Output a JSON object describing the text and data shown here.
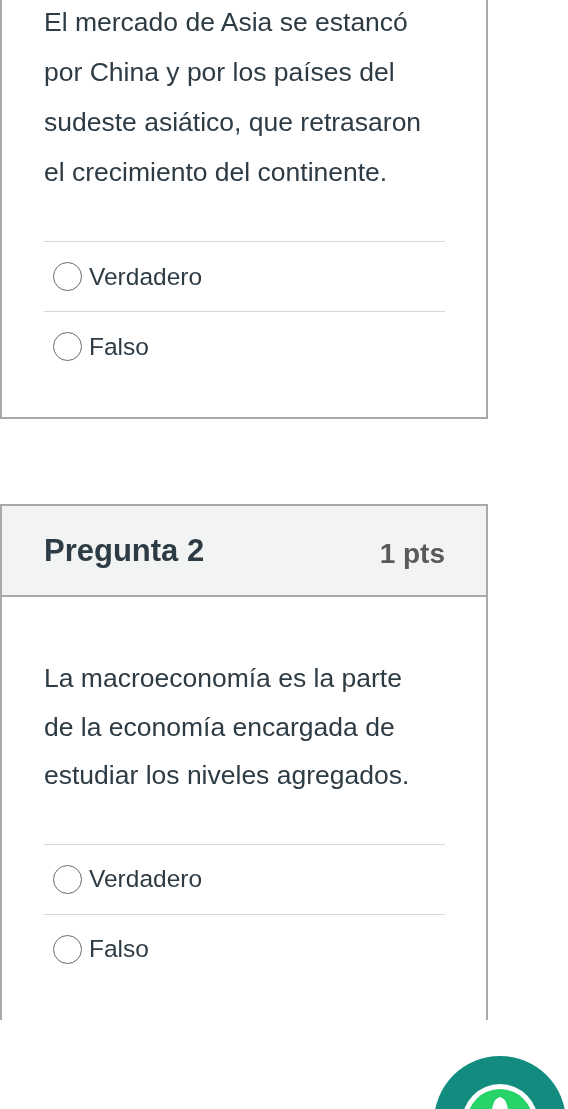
{
  "questions": [
    {
      "text": "El mercado de Asia se estancó por China y por los países del sudeste asiático, que retrasaron el crecimiento del continente.",
      "options": [
        {
          "label": "Verdadero",
          "selected": false
        },
        {
          "label": "Falso",
          "selected": false
        }
      ]
    },
    {
      "title": "Pregunta 2",
      "points": "1 pts",
      "text": "La macroeconomía es la parte de la economía encargada de estudiar los niveles agregados.",
      "options": [
        {
          "label": "Verdadero",
          "selected": false
        },
        {
          "label": "Falso",
          "selected": false
        }
      ]
    }
  ]
}
